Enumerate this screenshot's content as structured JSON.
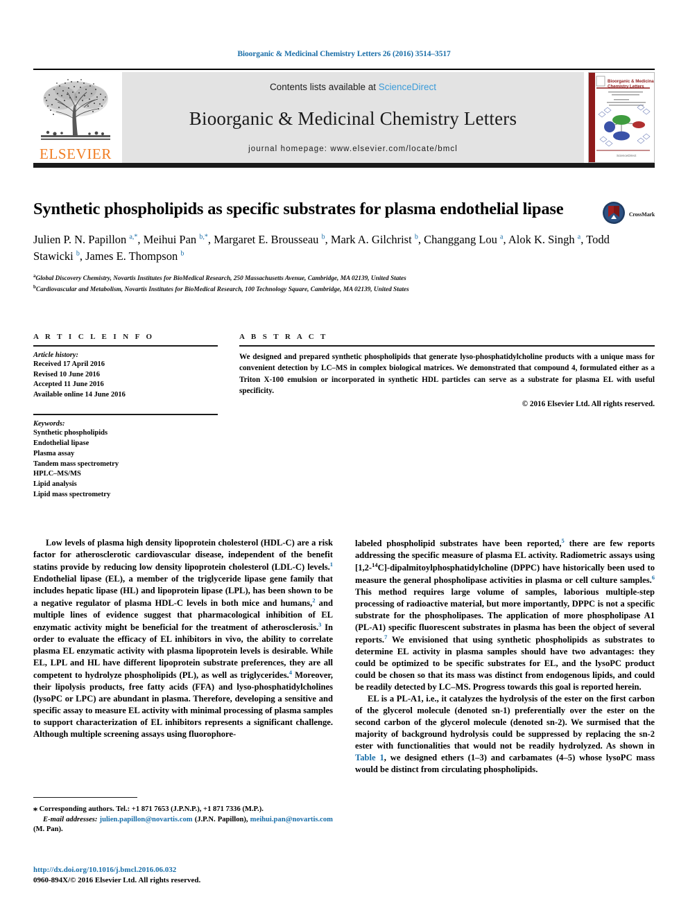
{
  "running_head": "Bioorganic & Medicinal Chemistry Letters 26 (2016) 3514–3517",
  "masthead": {
    "contents_prefix": "Contents lists available at ",
    "sciencedirect": "ScienceDirect",
    "journal_name": "Bioorganic & Medicinal Chemistry Letters",
    "homepage": "journal homepage: www.elsevier.com/locate/bmcl",
    "publisher": "ELSEVIER",
    "cover_title_line1": "Bioorganic & Medicinal",
    "cover_title_line2": "Chemistry Letters"
  },
  "article": {
    "title": "Synthetic phospholipids as specific substrates for plasma endothelial lipase",
    "crossmark_label": "CrossMark",
    "authors_html": "Julien P. N. Papillon <sup>a,*</sup>, Meihui Pan <sup>b,*</sup>, Margaret E. Brousseau <sup>b</sup>, Mark A. Gilchrist <sup>b</sup>, Changgang Lou <sup>a</sup>, Alok K. Singh <sup>a</sup>, Todd Stawicki <sup>b</sup>, James E. Thompson <sup>b</sup>",
    "affiliation_a": "Global Discovery Chemistry, Novartis Institutes for BioMedical Research, 250 Massachusetts Avenue, Cambridge, MA 02139, United States",
    "affiliation_b": "Cardiovascular and Metabolism, Novartis Institutes for BioMedical Research, 100 Technology Square, Cambridge, MA 02139, United States"
  },
  "article_info": {
    "heading": "A R T I C L E   I N F O",
    "history_label": "Article history:",
    "received": "Received 17 April 2016",
    "revised": "Revised 10 June 2016",
    "accepted": "Accepted 11 June 2016",
    "available": "Available online 14 June 2016",
    "keywords_label": "Keywords:",
    "keywords": [
      "Synthetic phospholipids",
      "Endothelial lipase",
      "Plasma assay",
      "Tandem mass spectrometry",
      "HPLC–MS/MS",
      "Lipid analysis",
      "Lipid mass spectrometry"
    ]
  },
  "abstract": {
    "heading": "A B S T R A C T",
    "text": "We designed and prepared synthetic phospholipids that generate lyso-phosphatidylcholine products with a unique mass for convenient detection by LC–MS in complex biological matrices. We demonstrated that compound 4, formulated either as a Triton X-100 emulsion or incorporated in synthetic HDL particles can serve as a substrate for plasma EL with useful specificity.",
    "copyright": "© 2016 Elsevier Ltd. All rights reserved."
  },
  "body": {
    "left_p1_html": "Low levels of plasma high density lipoprotein cholesterol (HDL-C) are a risk factor for atherosclerotic cardiovascular disease, independent of the benefit statins provide by reducing low density lipoprotein cholesterol (LDL-C) levels.<sup>1</sup> Endothelial lipase (EL), a member of the triglyceride lipase gene family that includes hepatic lipase (HL) and lipoprotein lipase (LPL), has been shown to be a negative regulator of plasma HDL-C levels in both mice and humans,<sup>2</sup> and multiple lines of evidence suggest that pharmacological inhibition of EL enzymatic activity might be beneficial for the treatment of atherosclerosis.<sup>3</sup> In order to evaluate the efficacy of EL inhibitors in vivo, the ability to correlate plasma EL enzymatic activity with plasma lipoprotein levels is desirable. While EL, LPL and HL have different lipoprotein substrate preferences, they are all competent to hydrolyze phospholipids (PL), as well as triglycerides.<sup>4</sup> Moreover, their lipolysis products, free fatty acids (FFA) and lyso-phosphatidylcholines (lysoPC or LPC) are abundant in plasma. Therefore, developing a sensitive and specific assay to measure EL activity with minimal processing of plasma samples to support characterization of EL inhibitors represents a significant challenge. Although multiple screening assays using fluorophore-",
    "right_p1_html": "labeled phospholipid substrates have been reported,<sup>5</sup> there are few reports addressing the specific measure of plasma EL activity. Radiometric assays using [1,2-<sup class=\"plain\">14</sup>C]-dipalmitoylphosphatidylcholine (DPPC) have historically been used to measure the general phospholipase activities in plasma or cell culture samples.<sup>6</sup> This method requires large volume of samples, laborious multiple-step processing of radioactive material, but more importantly, DPPC is not a specific substrate for the phospholipases. The application of more phospholipase A1 (PL-A1) specific fluorescent substrates in plasma has been the object of several reports.<sup>7</sup> We envisioned that using synthetic phospholipids as substrates to determine EL activity in plasma samples should have two advantages: they could be optimized to be specific substrates for EL, and the lysoPC product could be chosen so that its mass was distinct from endogenous lipids, and could be readily detected by LC–MS. Progress towards this goal is reported herein.",
    "right_p2_html": "EL is a PL-A1, i.e., it catalyzes the hydrolysis of the ester on the first carbon of the glycerol molecule (denoted sn-1) preferentially over the ester on the second carbon of the glycerol molecule (denoted sn-2). We surmised that the majority of background hydrolysis could be suppressed by replacing the sn-2 ester with functionalities that would not be readily hydrolyzed. As shown in <span class=\"reflink\">Table 1</span>, we designed ethers (<b>1–3</b>) and carbamates (<b>4–5</b>) whose lysoPC mass would be distinct from circulating phospholipids."
  },
  "footnotes": {
    "corresponding_html": "<span class=\"star\">⁎</span> Corresponding authors. Tel.: +1 871 7653 (J.P.N.P.), +1 871 7336 (M.P.).",
    "emails_html": "<i>E-mail addresses:</i> <span class=\"mail\">julien.papillon@novartis.com</span> (J.P.N. Papillon), <span class=\"mail\">meihui.pan@novartis.com</span> (M. Pan).",
    "doi": "http://dx.doi.org/10.1016/j.bmcl.2016.06.032",
    "issn": "0960-894X/© 2016 Elsevier Ltd. All rights reserved."
  },
  "colors": {
    "link_blue": "#1a6ea8",
    "sciencedirect_blue": "#3a9bd9",
    "elsevier_orange": "#F07C21",
    "band_gray": "#e3e3e3"
  }
}
